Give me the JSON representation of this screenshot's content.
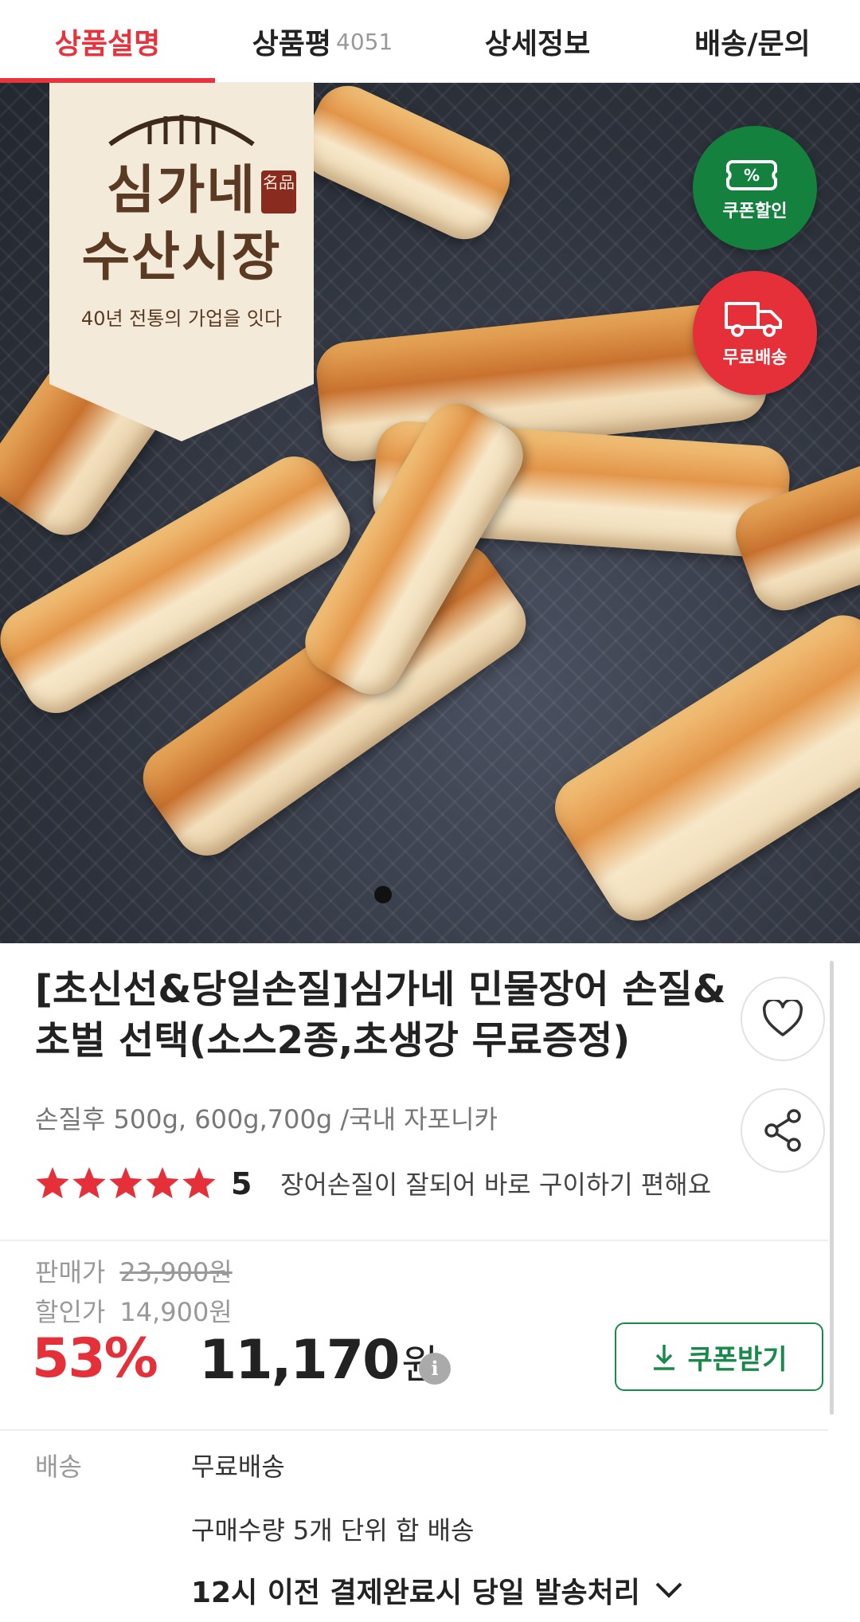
{
  "tabs": [
    {
      "label": "상품설명",
      "active": true
    },
    {
      "label": "상품평",
      "count": "4051"
    },
    {
      "label": "상세정보"
    },
    {
      "label": "배송/문의"
    }
  ],
  "hero": {
    "brand": {
      "name_line1": "심가네",
      "name_line2": "수산시장",
      "seal": "名品",
      "tagline": "40년 전통의 가업을 잇다"
    },
    "badges": {
      "coupon": "쿠폰할인",
      "coupon_icon_text": "%",
      "shipping": "무료배송"
    },
    "carousel": {
      "current": 1,
      "total": 1
    }
  },
  "product": {
    "title": "[초신선&당일손질]심가네 민물장어 손질&초벌 선택(소스2종,초생강 무료증정)",
    "subtitle": "손질후 500g, 600g,700g /국내 자포니카",
    "rating": {
      "stars": 5,
      "score": "5"
    },
    "review_summary": "장어손질이 잘되어 바로 구이하기 편해요",
    "icons": {
      "wishlist": "heart-icon",
      "share": "share-icon"
    }
  },
  "price": {
    "sale_label": "판매가",
    "sale_price": "23,900원",
    "discount_label": "할인가",
    "discount_price": "14,900원",
    "rate": "53%",
    "final_amount": "11,170",
    "final_unit": "원",
    "info_icon": "i",
    "coupon_button": "쿠폰받기"
  },
  "shipping": {
    "label": "배송",
    "fee": "무료배송",
    "bundle": "구매수량 5개 단위 합 배송",
    "dispatch": "12시 이전 결제완료시 당일 발송처리"
  },
  "colors": {
    "accent_red": "#e5303a",
    "coupon_green": "#14813e",
    "button_green": "#1a8a4a"
  }
}
